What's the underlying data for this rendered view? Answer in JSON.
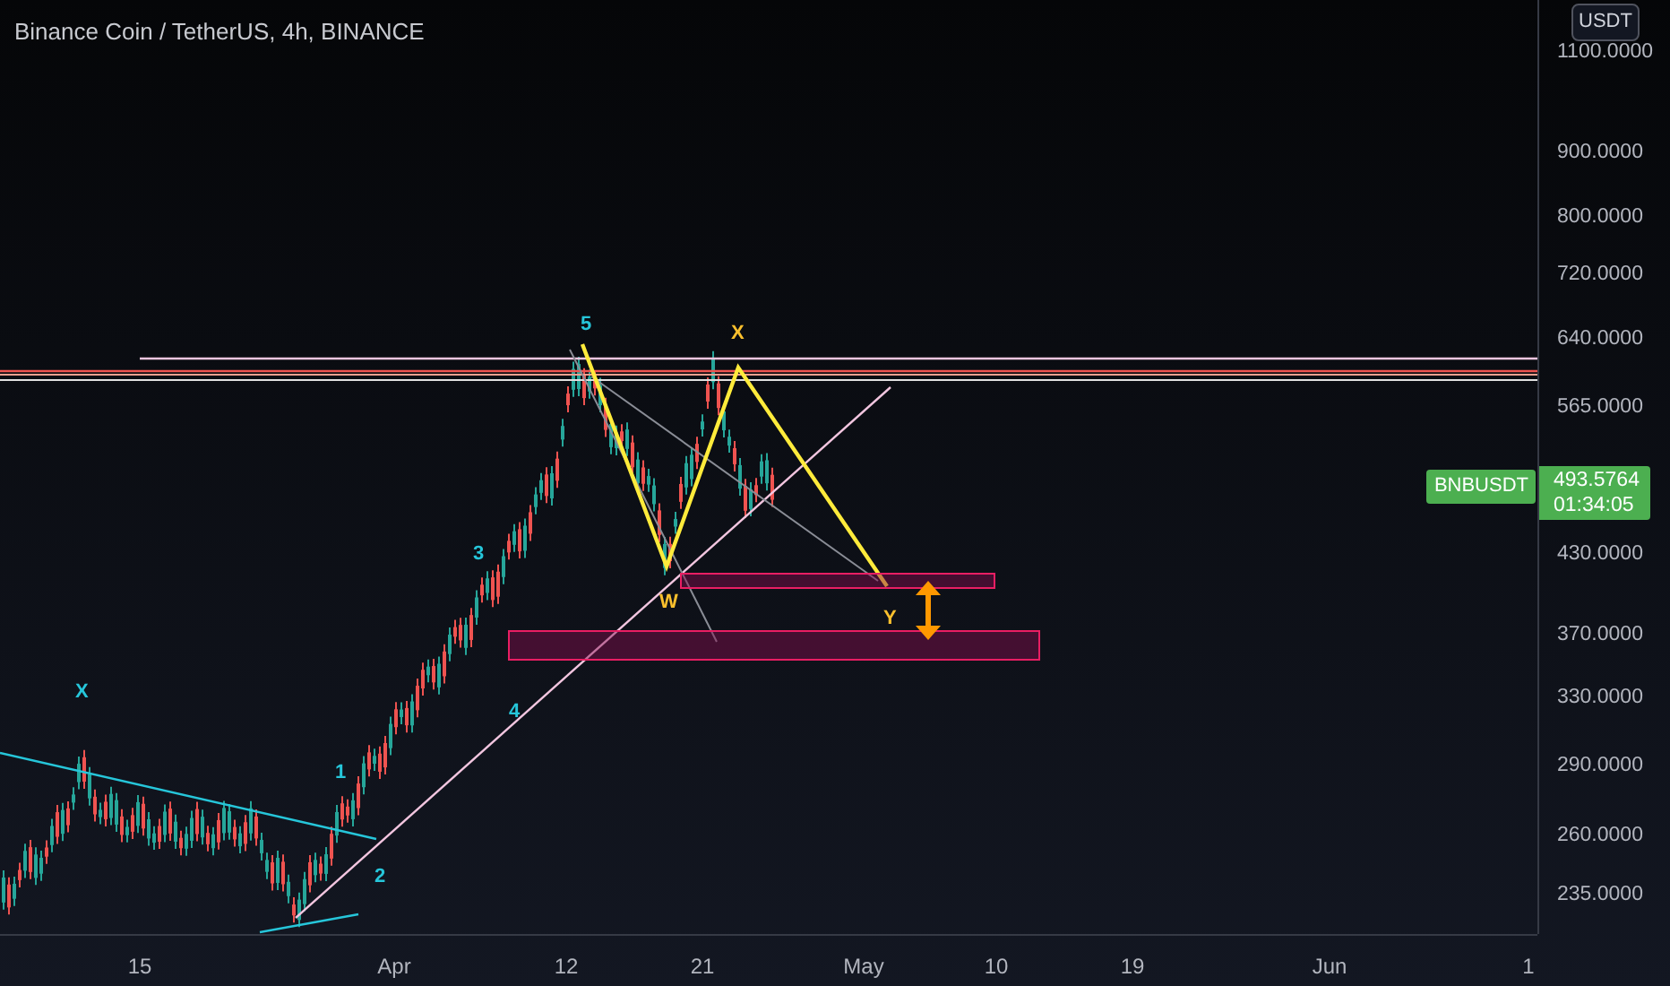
{
  "header": {
    "title": "Binance Coin / TetherUS, 4h, BINANCE"
  },
  "price_axis": {
    "currency": "USDT",
    "labels": [
      "1100.0000",
      "900.0000",
      "800.0000",
      "720.0000",
      "640.0000",
      "565.0000",
      "430.0000",
      "370.0000",
      "330.0000",
      "290.0000",
      "260.0000",
      "235.0000"
    ]
  },
  "price_tag": {
    "symbol": "BNBUSDT",
    "price": "493.5764",
    "countdown": "01:34:05"
  },
  "time_axis": {
    "labels": [
      "15",
      "Apr",
      "12",
      "21",
      "May",
      "10",
      "19",
      "Jun",
      "1"
    ]
  },
  "wave_labels": [
    {
      "text": "X",
      "color": "#26c6da"
    },
    {
      "text": "1",
      "color": "#26c6da"
    },
    {
      "text": "2",
      "color": "#26c6da"
    },
    {
      "text": "3",
      "color": "#26c6da"
    },
    {
      "text": "4",
      "color": "#26c6da"
    },
    {
      "text": "5",
      "color": "#26c6da"
    },
    {
      "text": "X",
      "color": "#fbc02d"
    },
    {
      "text": "W",
      "color": "#fbc02d"
    },
    {
      "text": "Y",
      "color": "#fbc02d"
    }
  ]
}
